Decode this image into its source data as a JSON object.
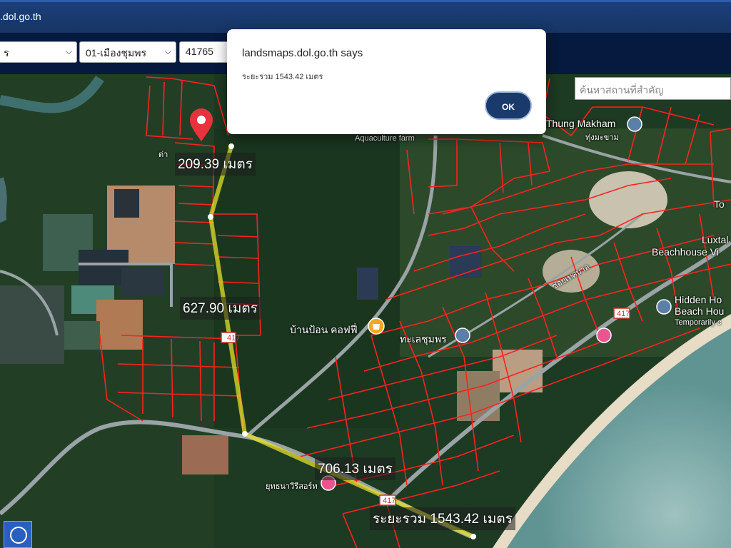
{
  "browser": {
    "url": ".dol.go.th"
  },
  "toolbar": {
    "province_select": "ร",
    "district_select": "01-เมืองชุมพร",
    "parcel_input": "41765"
  },
  "search": {
    "placeholder": "ค้นหาสถานที่สำคัญ"
  },
  "dialog": {
    "title": "landsmaps.dol.go.th says",
    "message": "ระยะรวม 1543.42 เมตร",
    "ok_label": "OK"
  },
  "measurements": {
    "segment_1": "209.39 เมตร",
    "segment_2": "627.90 เมตร",
    "segment_3": "706.13 เมตร",
    "total": "ระยะรวม 1543.42 เมตร"
  },
  "map_labels": {
    "aquaculture": "Aquaculture farm",
    "thung_makham": "Thung Makham",
    "thung_makham_th": "ทุ่งมะขาม",
    "luxtal": "Luxtal",
    "luxtal_beachhouse": "Beachhouse Vi",
    "hidden": "Hidden Ho",
    "hidden_beach": "Beach Hou",
    "temporarily": "Temporarily c",
    "cafe": "บ้านป้อน คอฟฟี่",
    "sea": "ทะเลชุมพร",
    "to": "To",
    "road_sign": "ซอยเทศบาล",
    "route_417": "417",
    "resort": "ยุทธนาวีรีสอร์ท",
    "marker_label": "ต่า"
  },
  "colors": {
    "parcel": "#ff2020",
    "route": "#e6e02a",
    "marker": "#e8323c",
    "topbar": "#1b3f7a",
    "toolbar": "#06193e",
    "ok_button": "#1a3a6b"
  },
  "icons": {
    "location_marker": "map-pin-icon",
    "cafe_marker": "coffee-pin-icon",
    "sea_marker": "place-pin-icon",
    "hotel_marker": "hotel-pin-icon",
    "tool": "circle-tool-icon"
  }
}
